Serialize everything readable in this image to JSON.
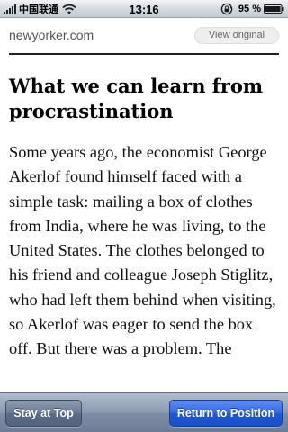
{
  "status_bar": {
    "carrier": "中国联通",
    "time": "13:16",
    "battery_percent": "95 %"
  },
  "header": {
    "site": "newyorker.com",
    "view_original_label": "View original"
  },
  "article": {
    "title": "What we can learn from procrastination",
    "body": "Some years ago, the economist George Akerlof found himself faced with a simple task: mailing a box of clothes from India, where he was living, to the United States. The clothes belonged to his friend and colleague Joseph Stiglitz, who had left them behind when visiting, so Akerlof was eager to send the box off. But there was a problem. The"
  },
  "toolbar": {
    "stay_label": "Stay at Top",
    "return_label": "Return to Position"
  }
}
